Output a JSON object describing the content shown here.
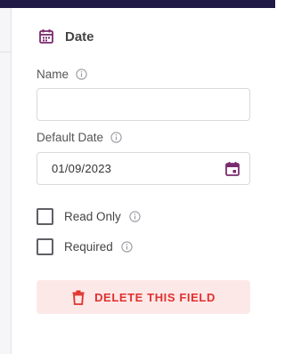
{
  "colors": {
    "accent": "#7a2b6e",
    "danger": "#e0312e",
    "danger_bg": "#fde8e8",
    "top_bar": "#1f1b46"
  },
  "header": {
    "icon": "calendar-icon",
    "title": "Date"
  },
  "name_field": {
    "label": "Name",
    "value": "",
    "placeholder": "",
    "info_icon": "info-icon"
  },
  "default_date": {
    "label": "Default Date",
    "value": "01/09/2023",
    "info_icon": "info-icon",
    "picker_icon": "calendar-icon"
  },
  "options": {
    "read_only": {
      "label": "Read Only",
      "checked": false
    },
    "required": {
      "label": "Required",
      "checked": false
    }
  },
  "delete_button": {
    "label": "DELETE THIS FIELD",
    "icon": "trash-icon"
  }
}
